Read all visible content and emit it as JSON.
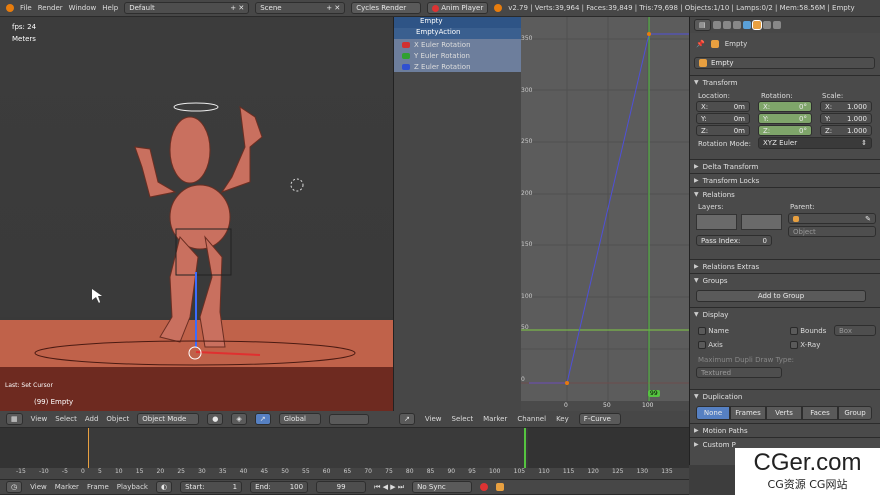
{
  "top_menu": {
    "file": "File",
    "render": "Render",
    "window": "Window",
    "help": "Help",
    "screen_layout": "Default",
    "scene": "Scene",
    "engine": "Cycles Render",
    "anim_player": "Anim Player",
    "stats": "v2.79 | Verts:39,964 | Faces:39,849 | Tris:79,698 | Objects:1/10 | Lamps:0/2 | Mem:58.56M | Empty"
  },
  "viewport": {
    "fps": "fps: 24",
    "units": "Meters",
    "last_op": "Last: Set Cursor",
    "object_label": "(99) Empty",
    "header": {
      "view": "View",
      "select": "Select",
      "add": "Add",
      "object": "Object",
      "mode": "Object Mode",
      "orientation": "Global"
    }
  },
  "dopesheet": {
    "channels": [
      {
        "label": "Empty"
      },
      {
        "label": "EmptyAction"
      },
      {
        "label": "X Euler Rotation",
        "color": "#d03030"
      },
      {
        "label": "Y Euler Rotation",
        "color": "#30a030"
      },
      {
        "label": "Z Euler Rotation",
        "color": "#3050d0"
      }
    ]
  },
  "graph": {
    "y_ticks": [
      "350",
      "300",
      "250",
      "200",
      "150",
      "100",
      "50",
      "0"
    ],
    "x_ticks": [
      "0",
      "50",
      "100"
    ],
    "current_frame": "99",
    "header": {
      "view": "View",
      "select": "Select",
      "marker": "Marker",
      "channel": "Channel",
      "key": "Key",
      "mode": "F-Curve"
    }
  },
  "timeline": {
    "ticks": [
      "-15",
      "-10",
      "-5",
      "0",
      "5",
      "10",
      "15",
      "20",
      "25",
      "30",
      "35",
      "40",
      "45",
      "50",
      "55",
      "60",
      "65",
      "70",
      "75",
      "80",
      "85",
      "90",
      "95",
      "100",
      "105",
      "110",
      "115",
      "120",
      "125",
      "130",
      "135"
    ],
    "header": {
      "view": "View",
      "marker": "Marker",
      "frame": "Frame",
      "playback": "Playback",
      "start": "Start:",
      "start_val": "1",
      "end": "End:",
      "end_val": "100",
      "current": "99",
      "sync": "No Sync"
    }
  },
  "properties": {
    "context": "Empty",
    "object_name": "Empty",
    "transform": {
      "title": "Transform",
      "location_label": "Location:",
      "rotation_label": "Rotation:",
      "scale_label": "Scale:",
      "location": [
        {
          "axis": "X:",
          "val": "0m"
        },
        {
          "axis": "Y:",
          "val": "0m"
        },
        {
          "axis": "Z:",
          "val": "0m"
        }
      ],
      "rotation": [
        {
          "axis": "X:",
          "val": "0°"
        },
        {
          "axis": "Y:",
          "val": "0°"
        },
        {
          "axis": "Z:",
          "val": "0°"
        }
      ],
      "scale": [
        {
          "axis": "X:",
          "val": "1.000"
        },
        {
          "axis": "Y:",
          "val": "1.000"
        },
        {
          "axis": "Z:",
          "val": "1.000"
        }
      ],
      "rotation_mode_label": "Rotation Mode:",
      "rotation_mode": "XYZ Euler"
    },
    "delta_transform": "Delta Transform",
    "transform_locks": "Transform Locks",
    "relations": {
      "title": "Relations",
      "layers": "Layers:",
      "parent": "Parent:",
      "parent_type": "Object",
      "pass_index": "Pass Index:",
      "pass_val": "0"
    },
    "relations_extras": "Relations Extras",
    "groups": {
      "title": "Groups",
      "add": "Add to Group"
    },
    "display": {
      "title": "Display",
      "name": "Name",
      "axis": "Axis",
      "bounds": "Bounds",
      "bounds_type": "Box",
      "xray": "X-Ray",
      "max_dupli": "Maximum Dupli Draw Type:",
      "textured": "Textured"
    },
    "duplication": {
      "title": "Duplication",
      "tabs": [
        "None",
        "Frames",
        "Verts",
        "Faces",
        "Group"
      ]
    },
    "motion_paths": "Motion Paths",
    "custom_props": "Custom P"
  },
  "watermark": {
    "main": "CGer.com",
    "sub": "CG资源 CG网站"
  }
}
